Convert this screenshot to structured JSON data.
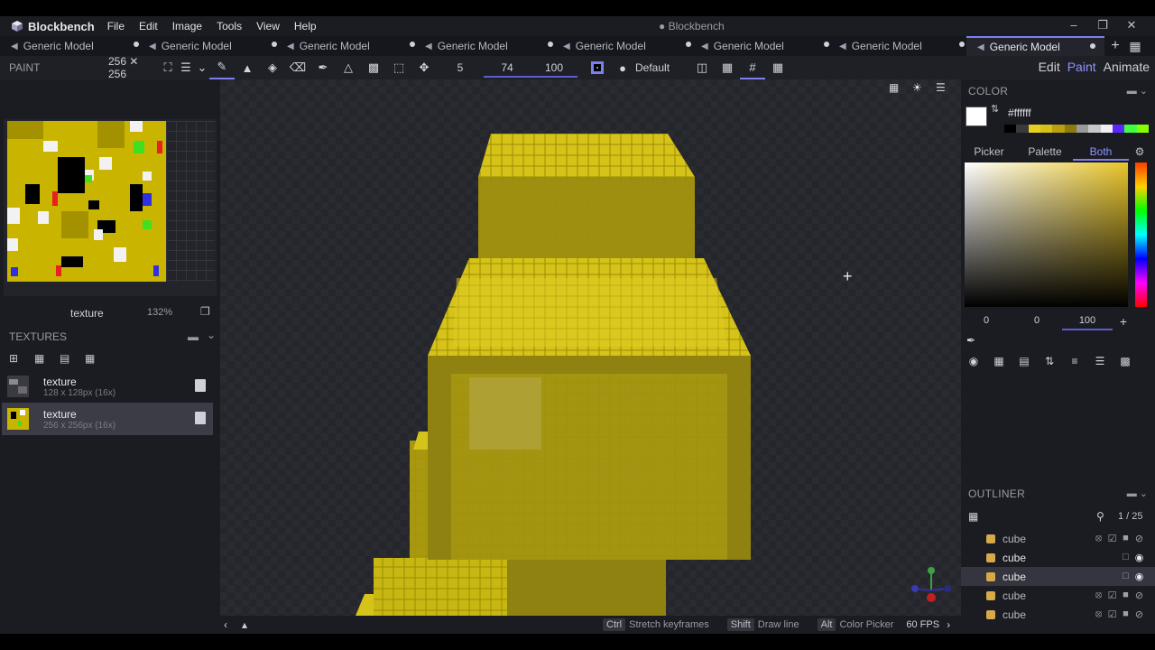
{
  "app": {
    "name": "Blockbench",
    "window_title": "● Blockbench",
    "menu": [
      "File",
      "Edit",
      "Image",
      "Tools",
      "View",
      "Help"
    ]
  },
  "tabs": [
    {
      "label": "Generic Model",
      "dirty": false,
      "active": false
    },
    {
      "label": "Generic Model",
      "dirty": true,
      "active": false
    },
    {
      "label": "Generic Model",
      "dirty": true,
      "active": false
    },
    {
      "label": "Generic Model",
      "dirty": true,
      "active": false
    },
    {
      "label": "Generic Model",
      "dirty": true,
      "active": false
    },
    {
      "label": "Generic Model",
      "dirty": true,
      "active": false
    },
    {
      "label": "Generic Model",
      "dirty": true,
      "active": false
    },
    {
      "label": "Generic Model",
      "dirty": true,
      "active": true
    }
  ],
  "toolbar": {
    "panel_label": "PAINT",
    "resolution": "256 ✕ 256",
    "brush_size": "5",
    "opacity": "74",
    "softness": "100",
    "blend_mode": "Default",
    "modes": [
      "Edit",
      "Paint",
      "Animate"
    ],
    "active_mode": "Paint"
  },
  "uv": {
    "texture_name": "texture",
    "zoom": "132%"
  },
  "textures": {
    "title": "TEXTURES",
    "items": [
      {
        "name": "texture",
        "meta": "128 x 128px (16x)",
        "selected": false
      },
      {
        "name": "texture",
        "meta": "256 x 256px (16x)",
        "selected": true
      }
    ]
  },
  "color": {
    "title": "COLOR",
    "hex": "#ffffff",
    "accent": "#7b7ff0",
    "palette_tabs": [
      "Picker",
      "Palette",
      "Both"
    ],
    "active_palette_tab": "Both",
    "h": "0",
    "s": "0",
    "v": "100",
    "palette_colors": [
      "#000000",
      "#3a3a3a",
      "#e8d020",
      "#d8c018",
      "#b8a010",
      "#8a7a10",
      "#9a9a9a",
      "#c8c8c8",
      "#f0f0f0",
      "#5a28ff",
      "#40ff40",
      "#88ff00"
    ]
  },
  "outliner": {
    "title": "OUTLINER",
    "count": "1 / 25",
    "items": [
      {
        "name": "cube",
        "visible": false,
        "selected": false
      },
      {
        "name": "cube",
        "visible": true,
        "selected": false
      },
      {
        "name": "cube",
        "visible": true,
        "selected": true
      },
      {
        "name": "cube",
        "visible": false,
        "selected": false
      },
      {
        "name": "cube",
        "visible": false,
        "selected": false
      }
    ]
  },
  "status": {
    "hints": [
      {
        "key": "Ctrl",
        "text": "Stretch keyframes"
      },
      {
        "key": "Shift",
        "text": "Draw line"
      },
      {
        "key": "Alt",
        "text": "Color Picker"
      }
    ],
    "fps": "60 FPS"
  }
}
